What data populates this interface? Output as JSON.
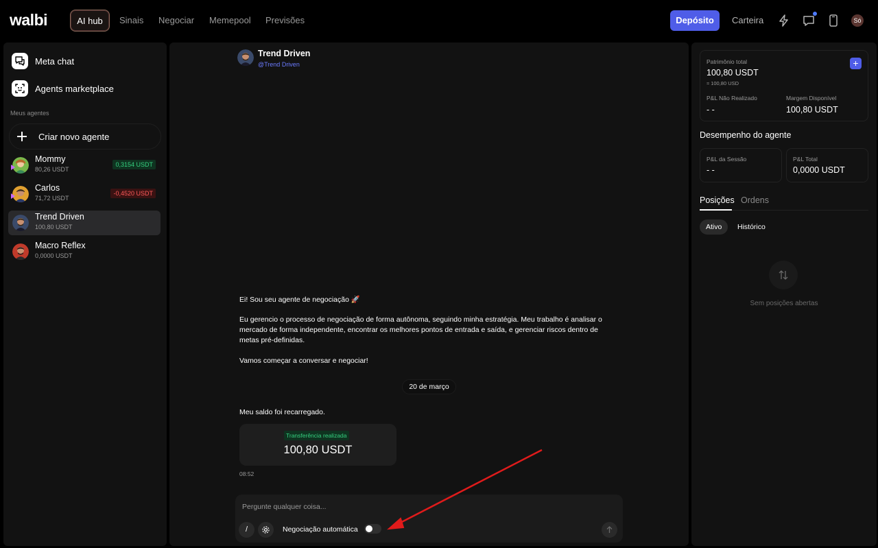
{
  "app": {
    "logo_text": "walbi"
  },
  "topnav": {
    "tabs": [
      {
        "label": "AI hub",
        "active": true
      },
      {
        "label": "Sinais"
      },
      {
        "label": "Negociar"
      },
      {
        "label": "Memepool"
      },
      {
        "label": "Previsões"
      }
    ],
    "deposit_label": "Depósito",
    "wallet_label": "Carteira",
    "user_initials": "Só",
    "accent_color": "#4f5de8"
  },
  "sidebar": {
    "meta_chat": "Meta chat",
    "marketplace": "Agents marketplace",
    "section_label": "Meus agentes",
    "create_label": "Criar novo agente",
    "agents": [
      {
        "name": "Mommy",
        "balance": "80,26 USDT",
        "pnl": "0,3154 USDT",
        "pnl_dir": "pos"
      },
      {
        "name": "Carlos",
        "balance": "71,72 USDT",
        "pnl": "-0,4520 USDT",
        "pnl_dir": "neg"
      },
      {
        "name": "Trend Driven",
        "balance": "100,80 USDT",
        "selected": true
      },
      {
        "name": "Macro Reflex",
        "balance": "0,0000 USDT"
      }
    ]
  },
  "chat": {
    "agent_name": "Trend Driven",
    "agent_handle": "@Trend Driven",
    "intro_line": "Ei! Sou seu agente de negociação 🚀",
    "intro_body": "Eu gerencio o processo de negociação de forma autônoma, seguindo minha estratégia. Meu trabalho é analisar o mercado de forma independente, encontrar os melhores pontos de entrada e saída, e gerenciar riscos dentro de metas pré-definidas.",
    "intro_cta": "Vamos começar a conversar e negociar!",
    "date_label": "20 de março",
    "balance_msg": "Meu saldo foi recarregado.",
    "transfer_badge": "Transferência realizada",
    "transfer_amount": "100,80 USDT",
    "msg_time": "08:52",
    "input_placeholder": "Pergunte qualquer coisa...",
    "slash_label": "/",
    "auto_trading_label": "Negociação automática",
    "auto_trading_on": false
  },
  "right": {
    "equity_label": "Patrimônio total",
    "equity_value": "100,80 USDT",
    "equity_usd": "≈ 100,80 USD",
    "unrealized_label": "P&L Não Realizado",
    "unrealized_value": "- -",
    "margin_label": "Margem Disponível",
    "margin_value": "100,80 USDT",
    "performance_title": "Desempenho do agente",
    "session_pnl_label": "P&L da Sessão",
    "session_pnl_value": "- -",
    "total_pnl_label": "P&L Total",
    "total_pnl_value": "0,0000 USDT",
    "tabs": [
      "Posições",
      "Ordens"
    ],
    "filters": [
      "Ativo",
      "Histórico"
    ],
    "empty_text": "Sem posições abertas"
  }
}
